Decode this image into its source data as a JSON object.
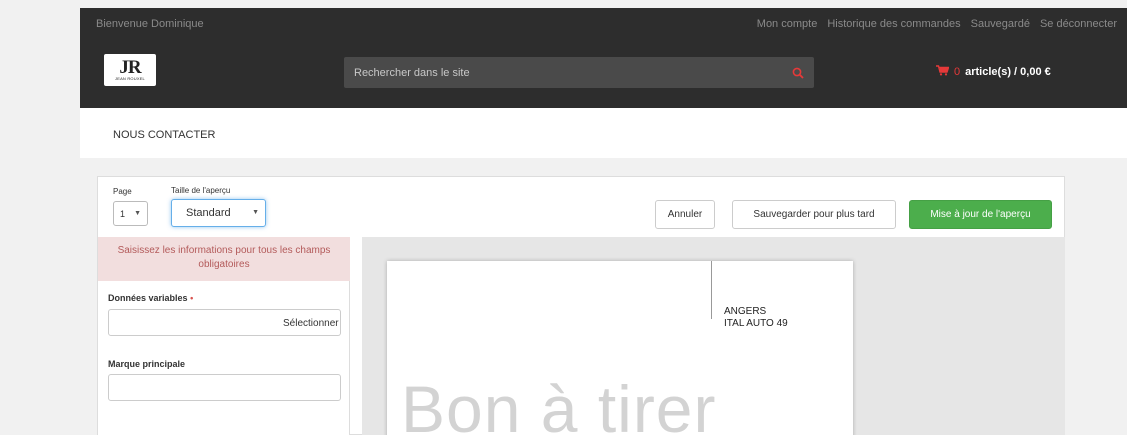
{
  "header": {
    "welcome": "Bienvenue Dominique",
    "links": [
      "Mon compte",
      "Historique des commandes",
      "Sauvegardé",
      "Se déconnecter"
    ],
    "logo": {
      "mark": "JR",
      "text": "JEAN ROUXEL"
    },
    "search": {
      "placeholder": "Rechercher dans le site",
      "icon": "search-icon"
    },
    "cart": {
      "icon": "cart-icon",
      "count": "0",
      "label": "article(s) / 0,00 €"
    }
  },
  "nav": {
    "contact": "NOUS CONTACTER"
  },
  "toolbar": {
    "page_label": "Page",
    "page_value": "1",
    "size_label": "Taille de l'aperçu",
    "size_value": "Standard",
    "cancel": "Annuler",
    "save_later": "Sauvegarder pour plus tard",
    "update": "Mise à jour de l'aperçu"
  },
  "form": {
    "alert": "Saisissez les informations pour tous les champs obligatoires",
    "variable_label": "Données variables",
    "required_mark": "•",
    "select_button": "Sélectionner",
    "brand_label": "Marque principale"
  },
  "preview": {
    "address_line1": "ANGERS",
    "address_line2": "ITAL AUTO 49",
    "watermark": "Bon à tirer"
  },
  "colors": {
    "accent": "#4cae4c",
    "alert_bg": "#f2dede",
    "cart": "#e63939",
    "topbar": "#2d2d2d"
  }
}
